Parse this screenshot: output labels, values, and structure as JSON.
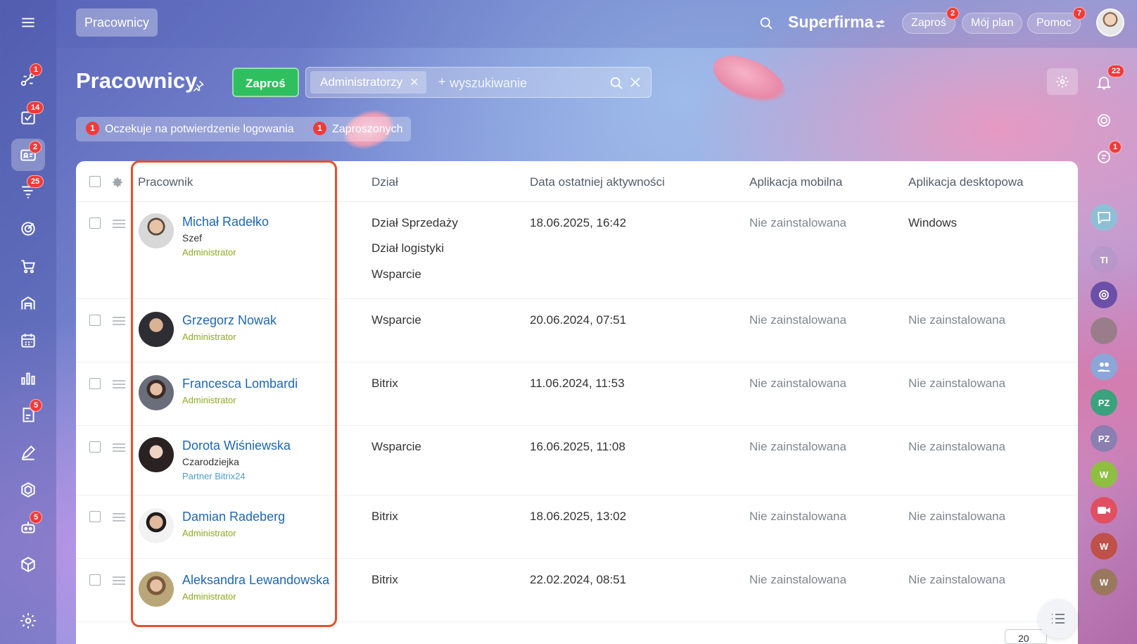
{
  "topbar": {
    "page_tab": "Pracownicy",
    "brand": "Superfirma",
    "invite_pill": "Zaproś",
    "invite_badge": "2",
    "plan_pill": "Mój plan",
    "help_pill": "Pomoc",
    "help_badge": "7"
  },
  "header": {
    "title": "Pracownicy",
    "invite_button": "Zaproś",
    "filter_chip": "Administratorzy",
    "search_placeholder": "wyszukiwanie",
    "search_plus": "+"
  },
  "counters": [
    {
      "count": "1",
      "label": "Oczekuje na potwierdzenie logowania"
    },
    {
      "count": "1",
      "label": "Zaproszonych"
    }
  ],
  "sidebar_left": {
    "badges": {
      "feed": "1",
      "tasks": "14",
      "employees": "2",
      "crm": "25",
      "docs": "5",
      "bots": "5"
    }
  },
  "sidebar_right": {
    "notifications_badge": "22",
    "chat_badge": "1",
    "initials": [
      "TI",
      "PZ",
      "PZ",
      "W",
      "W",
      "W"
    ]
  },
  "table": {
    "columns": [
      "Pracownik",
      "Dział",
      "Data ostatniej aktywności",
      "Aplikacja mobilna",
      "Aplikacja desktopowa"
    ],
    "rows": [
      {
        "name": "Michał Radełko",
        "post": "Szef",
        "role": "Administrator",
        "departments": [
          "Dział Sprzedaży",
          "Dział logistyki",
          "Wsparcie"
        ],
        "last_activity": "18.06.2025, 16:42",
        "mobile": "Nie zainstalowana",
        "desktop": "Windows"
      },
      {
        "name": "Grzegorz Nowak",
        "post": "",
        "role": "Administrator",
        "departments": [
          "Wsparcie"
        ],
        "last_activity": "20.06.2024, 07:51",
        "mobile": "Nie zainstalowana",
        "desktop": "Nie zainstalowana"
      },
      {
        "name": "Francesca Lombardi",
        "post": "",
        "role": "Administrator",
        "departments": [
          "Bitrix"
        ],
        "last_activity": "11.06.2024, 11:53",
        "mobile": "Nie zainstalowana",
        "desktop": "Nie zainstalowana"
      },
      {
        "name": "Dorota Wiśniewska",
        "post": "Czarodziejka",
        "role": "Partner Bitrix24",
        "departments": [
          "Wsparcie"
        ],
        "last_activity": "16.06.2025, 11:08",
        "mobile": "Nie zainstalowana",
        "desktop": "Nie zainstalowana"
      },
      {
        "name": "Damian Radeberg",
        "post": "",
        "role": "Administrator",
        "departments": [
          "Bitrix"
        ],
        "last_activity": "18.06.2025, 13:02",
        "mobile": "Nie zainstalowana",
        "desktop": "Nie zainstalowana"
      },
      {
        "name": "Aleksandra Lewandowska",
        "post": "",
        "role": "Administrator",
        "departments": [
          "Bitrix"
        ],
        "last_activity": "22.02.2024, 08:51",
        "mobile": "Nie zainstalowana",
        "desktop": "Nie zainstalowana"
      }
    ]
  },
  "pager": {
    "value": "20"
  },
  "colors": {
    "accent_green": "#2fbf5f",
    "link_blue": "#2067b0",
    "admin_green": "#8eaa1f",
    "highlight_red": "#e2512c",
    "badge_red": "#f23a3a"
  }
}
